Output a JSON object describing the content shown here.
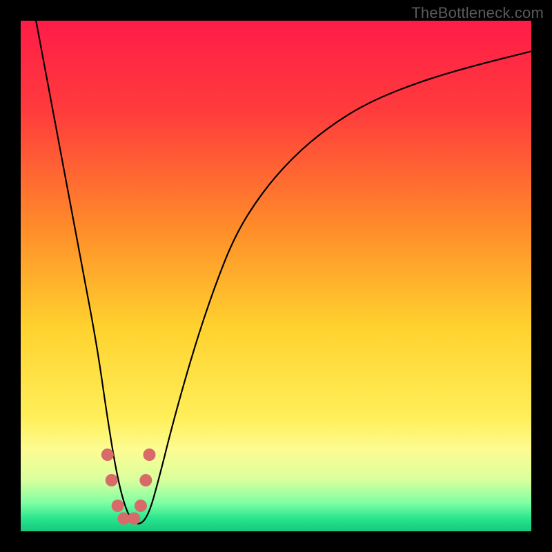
{
  "watermark": "TheBottleneck.com",
  "chart_data": {
    "type": "line",
    "title": "",
    "xlabel": "",
    "ylabel": "",
    "xlim": [
      0,
      100
    ],
    "ylim": [
      0,
      100
    ],
    "gradient_stops": [
      {
        "offset": 0,
        "color": "#ff1c48"
      },
      {
        "offset": 0.18,
        "color": "#ff3c3c"
      },
      {
        "offset": 0.4,
        "color": "#ff8a2a"
      },
      {
        "offset": 0.6,
        "color": "#ffd22e"
      },
      {
        "offset": 0.78,
        "color": "#ffef5a"
      },
      {
        "offset": 0.84,
        "color": "#fdfc92"
      },
      {
        "offset": 0.9,
        "color": "#d9ff9e"
      },
      {
        "offset": 0.945,
        "color": "#7dffa2"
      },
      {
        "offset": 0.975,
        "color": "#29e48e"
      },
      {
        "offset": 1.0,
        "color": "#17c87c"
      }
    ],
    "series": [
      {
        "name": "bottleneck-curve",
        "x": [
          3,
          6,
          9,
          12,
          15,
          17,
          19,
          21,
          23,
          25,
          27,
          30,
          34,
          38,
          42,
          47,
          53,
          60,
          68,
          78,
          88,
          100
        ],
        "y": [
          100,
          84,
          68,
          52,
          36,
          22,
          10,
          3,
          1,
          3,
          10,
          22,
          36,
          48,
          58,
          66,
          73,
          79,
          84,
          88,
          91,
          94
        ]
      }
    ],
    "markers": {
      "name": "highlight-dots",
      "color": "#d86a6a",
      "points": [
        {
          "x": 17.0,
          "y": 15.0
        },
        {
          "x": 17.8,
          "y": 10.0
        },
        {
          "x": 19.0,
          "y": 5.0
        },
        {
          "x": 20.2,
          "y": 2.5
        },
        {
          "x": 22.2,
          "y": 2.5
        },
        {
          "x": 23.5,
          "y": 5.0
        },
        {
          "x": 24.5,
          "y": 10.0
        },
        {
          "x": 25.2,
          "y": 15.0
        }
      ]
    }
  }
}
